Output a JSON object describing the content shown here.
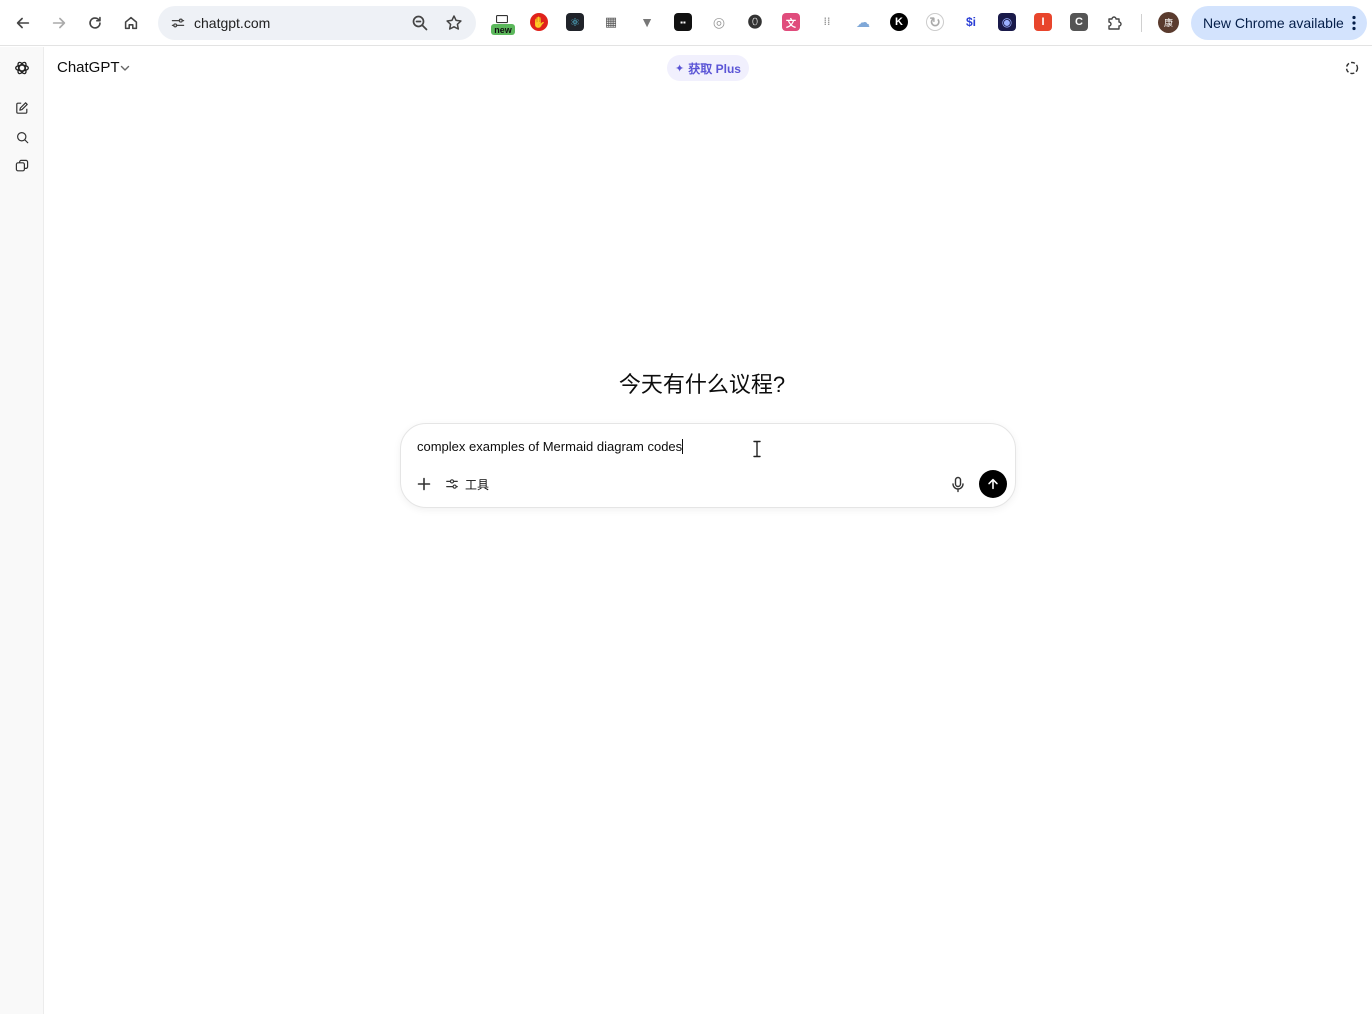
{
  "browser": {
    "url": "chatgpt.com",
    "new_badge": "new",
    "update_label": "New Chrome available",
    "profile_initial": "康",
    "extensions": [
      {
        "name": "adblock",
        "color": "#e0221b",
        "glyph": "✋"
      },
      {
        "name": "react-devtools",
        "color": "#20232a",
        "glyph": "⚛"
      },
      {
        "name": "qr",
        "color": "#ffffff",
        "glyph": "▦"
      },
      {
        "name": "vue-devtools",
        "color": "#ffffff",
        "glyph": "V"
      },
      {
        "name": "dual",
        "color": "#111111",
        "glyph": "▪▪"
      },
      {
        "name": "circle",
        "color": "#ffffff",
        "glyph": "◎"
      },
      {
        "name": "password",
        "color": "#ffffff",
        "glyph": "⓿"
      },
      {
        "name": "translate",
        "color": "#e04c7c",
        "glyph": "文"
      },
      {
        "name": "bars",
        "color": "#ffffff",
        "glyph": "⋮⋮"
      },
      {
        "name": "cloud",
        "color": "#ffffff",
        "glyph": "☁"
      },
      {
        "name": "k",
        "color": "#000000",
        "glyph": "K"
      },
      {
        "name": "share",
        "color": "#ffffff",
        "glyph": "↻"
      },
      {
        "name": "dollar",
        "color": "#ffffff",
        "glyph": "$i"
      },
      {
        "name": "screen",
        "color": "#1a1a4a",
        "glyph": "◉"
      },
      {
        "name": "i",
        "color": "#e8452c",
        "glyph": "I"
      },
      {
        "name": "c",
        "color": "#444444",
        "glyph": "C"
      }
    ]
  },
  "app": {
    "model_name": "ChatGPT",
    "get_plus_label": "获取 Plus",
    "greeting": "今天有什么议程?",
    "composer": {
      "value": "complex examples of Mermaid diagram codes",
      "tools_label": "工具"
    }
  }
}
